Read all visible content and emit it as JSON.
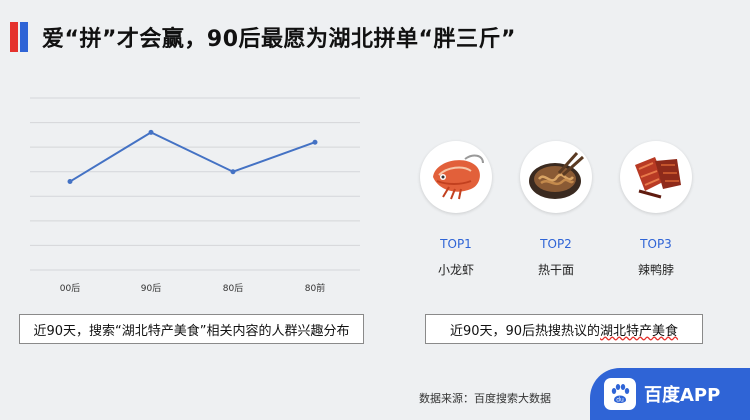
{
  "title": "爱“拼”才会赢，90后最愿为湖北拼单“胖三斤”",
  "colors": {
    "accent_red": "#e5322d",
    "accent_blue": "#2f64d6",
    "line": "#4472c4"
  },
  "chart_data": {
    "type": "line",
    "categories": [
      "00后",
      "90后",
      "80后",
      "80前"
    ],
    "series": [
      {
        "values": [
          3.6,
          5.6,
          4.0,
          5.2
        ]
      }
    ],
    "ylim": [
      0,
      7
    ],
    "grid": true,
    "title": "",
    "xlabel": "",
    "ylabel": ""
  },
  "caption_left": "近90天，搜索“湖北特产美食”相关内容的人群兴趣分布",
  "caption_right": {
    "prefix": "近90天，90后热搜热议的",
    "underlined": "湖北特产美食"
  },
  "foods": [
    {
      "rank": "TOP1",
      "name": "小龙虾",
      "icon": "crayfish-icon"
    },
    {
      "rank": "TOP2",
      "name": "热干面",
      "icon": "noodles-icon"
    },
    {
      "rank": "TOP3",
      "name": "辣鸭脖",
      "icon": "duck-neck-icon"
    }
  ],
  "source": "数据来源：百度搜索大数据",
  "app_name": "百度APP"
}
